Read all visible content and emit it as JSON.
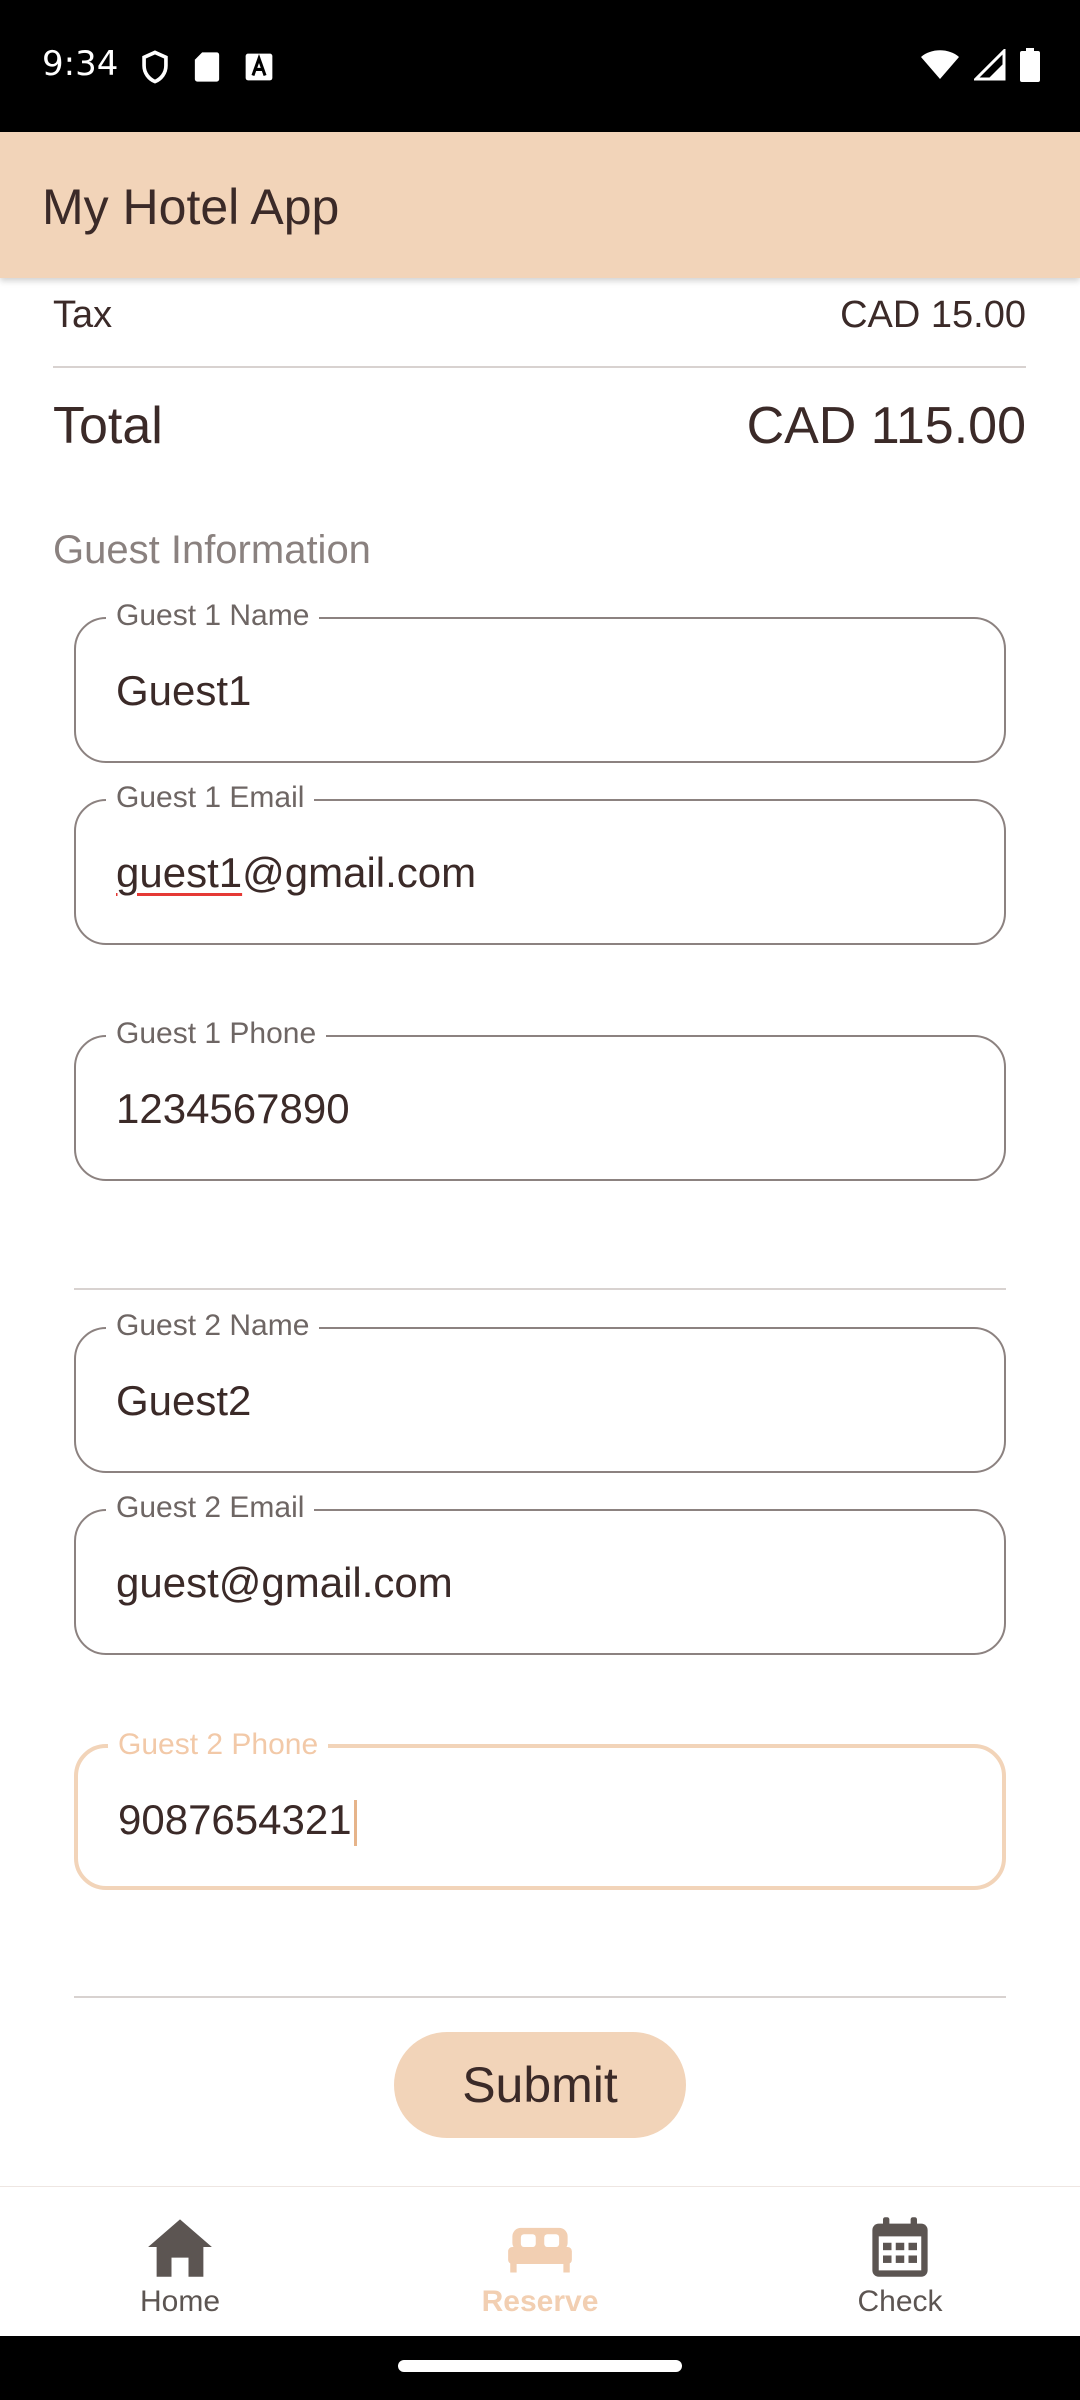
{
  "status_bar": {
    "time": "9:34",
    "icons_left": [
      "shield-icon",
      "sd-card-icon",
      "font-a-icon"
    ],
    "icons_right": [
      "wifi-icon",
      "signal-icon",
      "battery-icon"
    ]
  },
  "app_bar": {
    "title": "My Hotel App"
  },
  "summary": {
    "tax_label": "Tax",
    "tax_value": "CAD 15.00",
    "total_label": "Total",
    "total_value": "CAD 115.00"
  },
  "guest_section": {
    "title": "Guest Information",
    "guests": [
      {
        "name_label": "Guest 1 Name",
        "name_value": "Guest1",
        "email_label": "Guest 1 Email",
        "email_value_misspelled": "guest1",
        "email_value_rest": "@gmail.com",
        "phone_label": "Guest 1 Phone",
        "phone_value": "1234567890"
      },
      {
        "name_label": "Guest 2 Name",
        "name_value": "Guest2",
        "email_label": "Guest 2 Email",
        "email_value": "guest@gmail.com",
        "phone_label": "Guest 2 Phone",
        "phone_value": "9087654321"
      }
    ]
  },
  "submit_label": "Submit",
  "bottom_nav": {
    "items": [
      {
        "label": "Home",
        "icon": "home-icon",
        "active": false
      },
      {
        "label": "Reserve",
        "icon": "bed-icon",
        "active": true
      },
      {
        "label": "Check",
        "icon": "calendar-icon",
        "active": false
      }
    ]
  },
  "colors": {
    "accent": "#f2d4b9",
    "text": "#3b2a28",
    "muted": "#8a817f",
    "outline": "#8c8280",
    "spellcheck": "#e53935"
  }
}
